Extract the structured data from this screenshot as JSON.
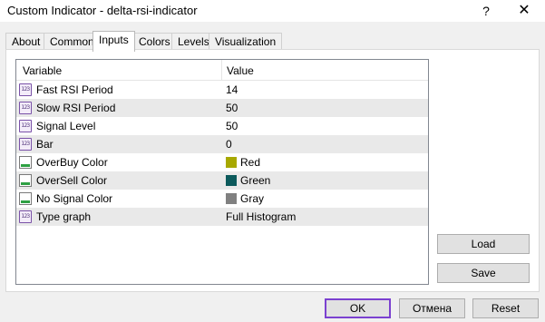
{
  "window": {
    "title": "Custom Indicator - delta-rsi-indicator",
    "help_label": "?",
    "close_label": "✕"
  },
  "tabs": [
    {
      "label": "About"
    },
    {
      "label": "Common"
    },
    {
      "label": "Inputs",
      "active": true
    },
    {
      "label": "Colors"
    },
    {
      "label": "Levels"
    },
    {
      "label": "Visualization"
    }
  ],
  "grid": {
    "columns": [
      "Variable",
      "Value"
    ],
    "rows": [
      {
        "icon": "numeric-input-icon",
        "name": "Fast RSI Period",
        "value": "14"
      },
      {
        "icon": "numeric-input-icon",
        "name": "Slow RSI Period",
        "value": "50"
      },
      {
        "icon": "numeric-input-icon",
        "name": "Signal Level",
        "value": "50"
      },
      {
        "icon": "numeric-input-icon",
        "name": "Bar",
        "value": "0"
      },
      {
        "icon": "color-input-icon",
        "name": "OverBuy Color",
        "value": "Red",
        "swatch": "#a7a800"
      },
      {
        "icon": "color-input-icon",
        "name": "OverSell Color",
        "value": "Green",
        "swatch": "#0c5a5c"
      },
      {
        "icon": "color-input-icon",
        "name": "No Signal Color",
        "value": "Gray",
        "swatch": "#808080"
      },
      {
        "icon": "numeric-input-icon",
        "name": "Type graph",
        "value": "Full Histogram"
      }
    ]
  },
  "side_buttons": {
    "load": "Load",
    "save": "Save"
  },
  "footer_buttons": {
    "ok": "OK",
    "cancel": "Отмена",
    "reset": "Reset"
  },
  "colors": {
    "accent_default_button": "#7b41d0",
    "row_shade": "#e9e9e9"
  }
}
